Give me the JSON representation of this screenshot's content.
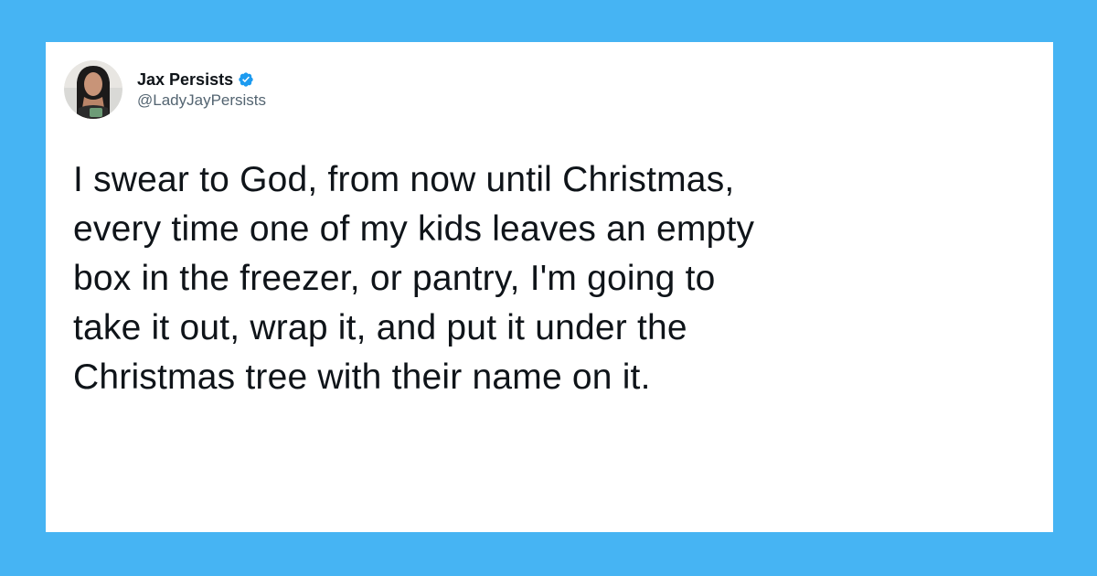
{
  "colors": {
    "background": "#46b4f3",
    "card": "#ffffff",
    "text": "#0f1419",
    "handle": "#536471",
    "verified_badge": "#1d9bf0"
  },
  "author": {
    "display_name": "Jax Persists",
    "handle": "@LadyJayPersists",
    "verified": true,
    "avatar_icon": "profile-photo"
  },
  "tweet": {
    "text": "I swear to God, from now until Christmas,\nevery time one of my kids leaves an empty\nbox in the freezer, or pantry, I'm going to\ntake it out, wrap it, and put it under the\nChristmas tree with their name on it."
  }
}
